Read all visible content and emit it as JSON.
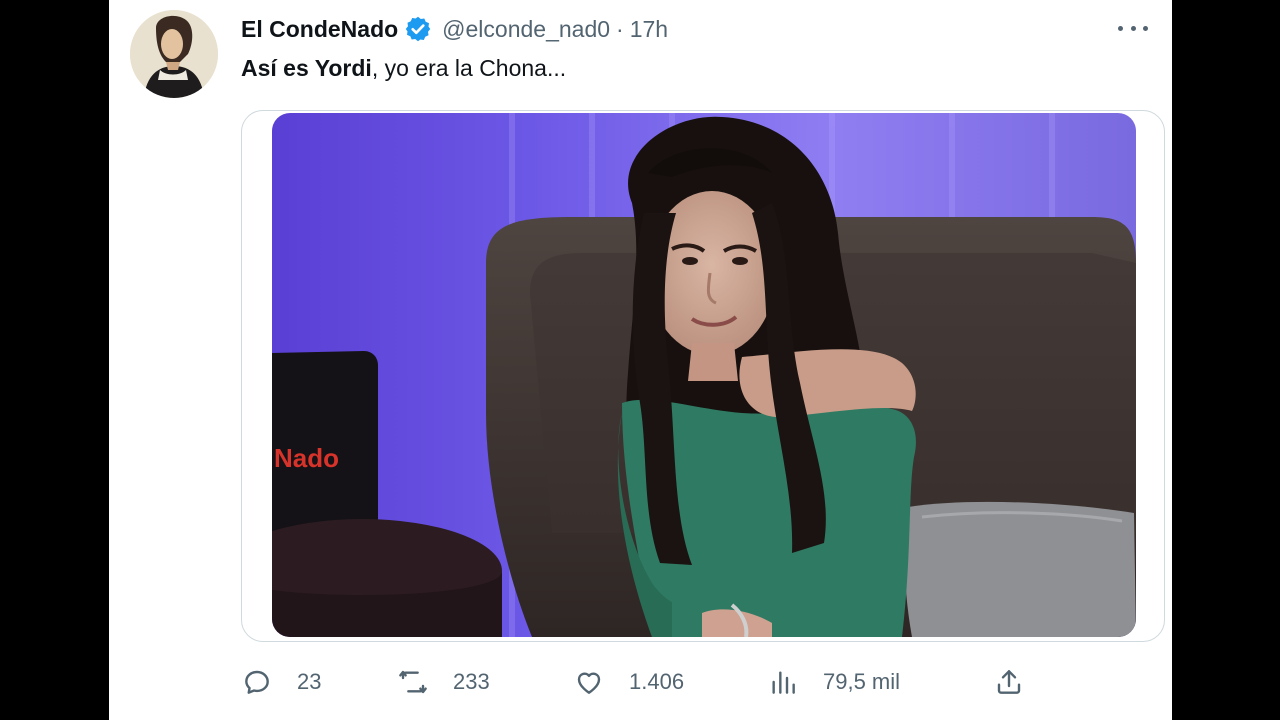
{
  "tweet": {
    "display_name": "El CondeNado",
    "handle": "@elconde_nad0",
    "separator": "·",
    "time": "17h",
    "text_bold": "Así es Yordi",
    "text_rest": ", yo era la Chona...",
    "photo_overlay_text": "Nado"
  },
  "actions": {
    "replies": "23",
    "retweets": "233",
    "likes": "1.406",
    "views": "79,5 mil"
  },
  "colors": {
    "text": "#0f1419",
    "secondary": "#536471",
    "verified": "#1d9bf0",
    "border": "#cfd9de"
  },
  "icons": [
    "verified-badge-icon",
    "more-icon",
    "reply-icon",
    "retweet-icon",
    "like-icon",
    "views-icon",
    "share-icon"
  ]
}
